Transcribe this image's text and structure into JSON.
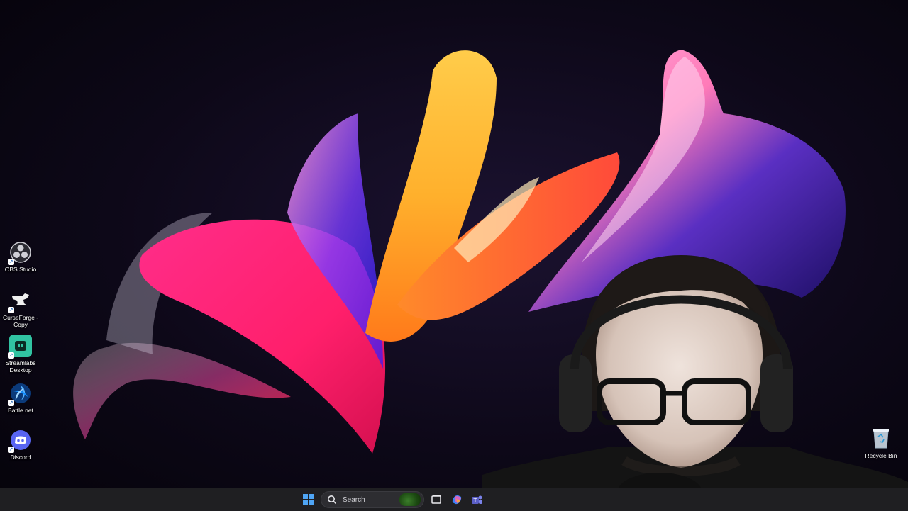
{
  "desktop": {
    "icons": [
      {
        "label": "OBS Studio",
        "icon": "obs-studio-icon",
        "color": "#2b2b33"
      },
      {
        "label": "CurseForge - Copy",
        "icon": "curseforge-icon",
        "color": "#1e1e24"
      },
      {
        "label": "Streamlabs Desktop",
        "icon": "streamlabs-icon",
        "color": "#31c3a2"
      },
      {
        "label": "Battle.net",
        "icon": "battlenet-icon",
        "color": "#148eff"
      },
      {
        "label": "Discord",
        "icon": "discord-icon",
        "color": "#5865f2"
      }
    ],
    "recycle_bin": {
      "label": "Recycle Bin",
      "icon": "recycle-bin-icon"
    }
  },
  "taskbar": {
    "start_icon": "windows-start-icon",
    "search": {
      "placeholder": "Search",
      "icon": "search-icon"
    },
    "pinned": [
      {
        "icon": "task-view-icon"
      },
      {
        "icon": "copilot-icon"
      },
      {
        "icon": "teams-icon"
      }
    ],
    "accent": "#4fa5f5"
  }
}
